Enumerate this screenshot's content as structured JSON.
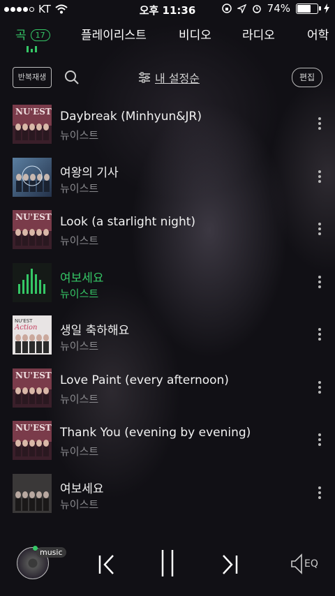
{
  "status": {
    "carrier": "KT",
    "time": "오후 11:36",
    "battery": "74%",
    "battery_level": 0.74
  },
  "tabs": [
    {
      "label": "곡",
      "badge": "17"
    },
    {
      "label": "플레이리스트"
    },
    {
      "label": "비디오"
    },
    {
      "label": "라디오"
    },
    {
      "label": "어학"
    }
  ],
  "toolbar": {
    "repeat": "반복재생",
    "sort": "내 설정순",
    "edit": "편집"
  },
  "songs": [
    {
      "title": "Daybreak (Minhyun&JR)",
      "artist": "뉴이스트",
      "playing": false
    },
    {
      "title": "여왕의 기사",
      "artist": "뉴이스트",
      "playing": false
    },
    {
      "title": "Look (a starlight night)",
      "artist": "뉴이스트",
      "playing": false
    },
    {
      "title": "여보세요",
      "artist": "뉴이스트",
      "playing": true
    },
    {
      "title": "생일 축하해요",
      "artist": "뉴이스트",
      "playing": false
    },
    {
      "title": "Love Paint (every afternoon)",
      "artist": "뉴이스트",
      "playing": false
    },
    {
      "title": "Thank You (evening by evening)",
      "artist": "뉴이스트",
      "playing": false
    },
    {
      "title": "여보세요",
      "artist": "뉴이스트",
      "playing": false
    }
  ],
  "player": {
    "tag": "music",
    "eq": "EQ"
  },
  "colors": {
    "accent": "#35c766"
  }
}
